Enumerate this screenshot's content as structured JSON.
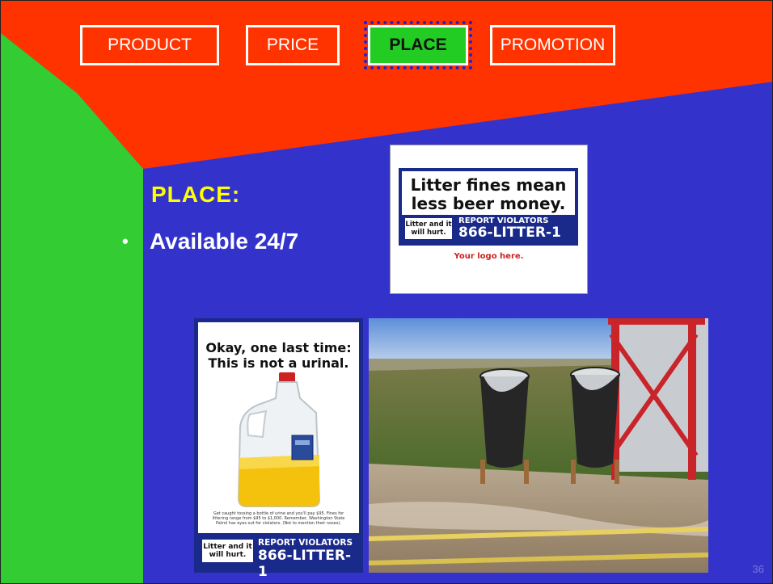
{
  "nav": {
    "tabs": [
      {
        "label": "PRODUCT",
        "active": false
      },
      {
        "label": "PRICE",
        "active": false
      },
      {
        "label": "PLACE",
        "active": true
      },
      {
        "label": "PROMOTION",
        "active": false
      }
    ]
  },
  "content": {
    "heading": "PLACE:",
    "bullets": [
      "Available 24/7"
    ]
  },
  "ads": {
    "top_ad": {
      "headline": "Litter fines mean less beer money.",
      "slogan": "Litter and it will hurt.",
      "report": "REPORT VIOLATORS",
      "phone": "866-LITTER-1",
      "logo_text": "Your logo here."
    },
    "poster": {
      "headline": "Okay, one last time: This is not a urinal.",
      "fine_print": "Get caught tossing a bottle of urine and you'll pay $95. Fines for littering range from $95 to $1,000. Remember, Washington State Patrol has eyes out for violators. (Not to mention their noses).",
      "slogan": "Litter and it will hurt.",
      "report": "REPORT VIOLATORS",
      "phone": "866-LITTER-1"
    },
    "photo": {
      "icon": "trash-cans-photo"
    }
  },
  "slide_number": "36",
  "colors": {
    "background": "#3333cc",
    "red_banner": "#ff3300",
    "green_band": "#33cc33",
    "heading_yellow": "#ffff00",
    "ad_blue": "#1a2a8a"
  }
}
